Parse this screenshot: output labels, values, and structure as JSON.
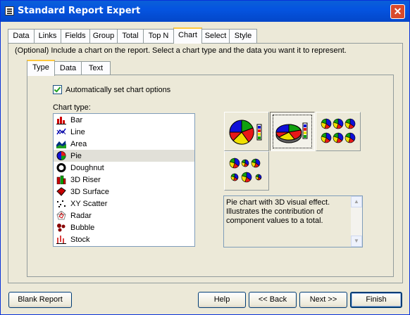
{
  "window": {
    "title": "Standard Report Expert",
    "close_glyph": "✕"
  },
  "tabs": [
    "Data",
    "Links",
    "Fields",
    "Group",
    "Total",
    "Top N",
    "Chart",
    "Select",
    "Style"
  ],
  "active_tab": "Chart",
  "description": "(Optional) Include a chart on the report. Select a chart type and the data you want it to represent.",
  "inner_tabs": [
    "Type",
    "Data",
    "Text"
  ],
  "active_inner_tab": "Type",
  "auto_options": {
    "label": "Automatically set chart options",
    "checked": true
  },
  "chart_type_label": "Chart type:",
  "chart_types": [
    {
      "label": "Bar",
      "icon": "bar-chart-icon"
    },
    {
      "label": "Line",
      "icon": "line-chart-icon"
    },
    {
      "label": "Area",
      "icon": "area-chart-icon"
    },
    {
      "label": "Pie",
      "icon": "pie-chart-icon",
      "selected": true
    },
    {
      "label": "Doughnut",
      "icon": "doughnut-chart-icon"
    },
    {
      "label": "3D Riser",
      "icon": "3d-riser-chart-icon"
    },
    {
      "label": "3D Surface",
      "icon": "3d-surface-chart-icon"
    },
    {
      "label": "XY Scatter",
      "icon": "scatter-chart-icon"
    },
    {
      "label": "Radar",
      "icon": "radar-chart-icon"
    },
    {
      "label": "Bubble",
      "icon": "bubble-chart-icon"
    },
    {
      "label": "Stock",
      "icon": "stock-chart-icon"
    }
  ],
  "subtype_description": "Pie chart with 3D visual effect. Illustrates the contribution of component values to a total.",
  "buttons": {
    "blank_report": "Blank Report",
    "help": "Help",
    "back": "<< Back",
    "next": "Next >>",
    "finish": "Finish"
  },
  "colors": {
    "pie_blue": "#1010d8",
    "pie_red": "#e81818",
    "pie_yellow": "#f0e000",
    "pie_green": "#10a010"
  }
}
